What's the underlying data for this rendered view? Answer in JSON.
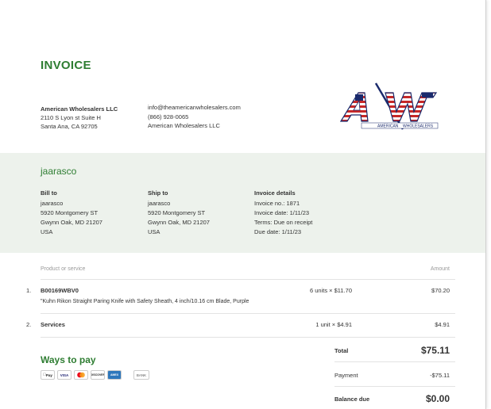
{
  "document": {
    "title": "INVOICE"
  },
  "company": {
    "name": "American Wholesalers LLC",
    "address1": "2110 S Lyon st Suite H",
    "address2": "Santa Ana, CA 92705",
    "email": "info@theamericanwholesalers.com",
    "phone": "(866) 928-0065",
    "contact_name": "American Wholesalers LLC",
    "logo_text": "AW",
    "logo_tagline_left": "AMERICAN",
    "logo_tagline_right": "WHOLESALERS"
  },
  "customer": {
    "display_name": "jaarasco"
  },
  "bill_to": {
    "heading": "Bill to",
    "lines": [
      "jaarasco",
      "5920 Montgomery ST",
      "Gwynn Oak, MD 21207",
      "USA"
    ]
  },
  "ship_to": {
    "heading": "Ship to",
    "lines": [
      "jaarasco",
      "5920 Montgomery ST",
      "Gwynn Oak, MD 21207",
      "USA"
    ]
  },
  "invoice_details": {
    "heading": "Invoice details",
    "lines": [
      "Invoice no.: 1871",
      "Invoice date: 1/11/23",
      "Terms: Due on receipt",
      "Due date: 1/11/23"
    ]
  },
  "table": {
    "col_product": "Product or service",
    "col_amount": "Amount",
    "rows": [
      {
        "num": "1.",
        "sku": "B00169WBV0",
        "description": "\"Kuhn Rikon Straight Paring Knife with Safety Sheath, 4 inch/10.16 cm Blade, Purple",
        "qty_rate": "6 units × $11.70",
        "amount": "$70.20"
      },
      {
        "num": "2.",
        "sku": "Services",
        "description": "",
        "qty_rate": "1 unit × $4.91",
        "amount": "$4.91"
      }
    ]
  },
  "payment": {
    "heading": "Ways to pay",
    "methods": [
      "Pay",
      "VISA",
      "mc",
      "DISCOVER",
      "AMEX",
      "BANK"
    ]
  },
  "totals": {
    "total_label": "Total",
    "total_value": "$75.11",
    "payment_label": "Payment",
    "payment_value": "-$75.11",
    "balance_label": "Balance due",
    "balance_value": "$0.00"
  },
  "colors": {
    "accent": "#2e7d32",
    "band": "#edf2ec",
    "logo_red": "#c62828",
    "logo_blue": "#1a2a6c"
  }
}
